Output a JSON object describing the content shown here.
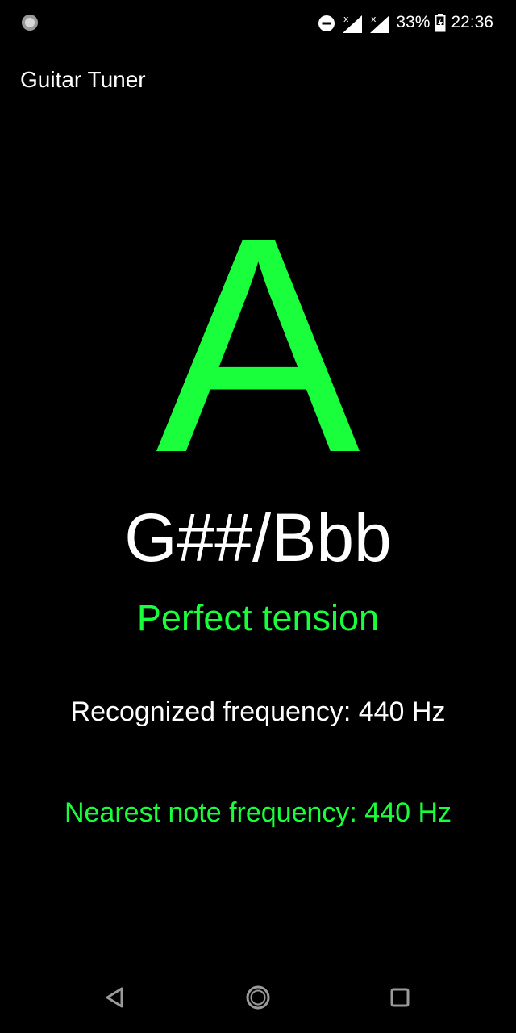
{
  "status_bar": {
    "left_icon": "record-circle-icon",
    "icons": [
      "do-not-disturb-icon",
      "signal-no-data-icon",
      "signal-no-data-icon",
      "battery-charging-icon"
    ],
    "battery_percent": "33%",
    "time": "22:36"
  },
  "app": {
    "title": "Guitar Tuner"
  },
  "tuner": {
    "note": "A",
    "enharmonic": "G##/Bbb",
    "tension_status": "Perfect tension",
    "recognized_frequency": "Recognized frequency: 440 Hz",
    "nearest_frequency": "Nearest note frequency: 440 Hz"
  },
  "nav": {
    "back_icon": "back-triangle-icon",
    "home_icon": "home-circle-icon",
    "recent_icon": "recent-apps-square-icon"
  },
  "colors": {
    "background": "#000000",
    "accent": "#1aff3c",
    "text": "#ffffff"
  }
}
